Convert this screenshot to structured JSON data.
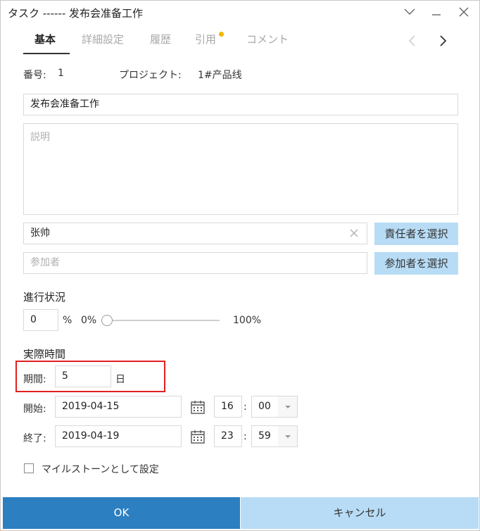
{
  "window": {
    "title": "タスク ------ 发布会准备工作"
  },
  "tabs": [
    {
      "label": "基本",
      "active": true
    },
    {
      "label": "詳細設定",
      "active": false
    },
    {
      "label": "履歴",
      "active": false
    },
    {
      "label": "引用",
      "active": false,
      "badge": true
    },
    {
      "label": "コメント",
      "active": false
    }
  ],
  "info": {
    "number_label": "番号:",
    "number_value": "1",
    "project_label": "プロジェクト:",
    "project_value": "1#产品线"
  },
  "form": {
    "task_name": "发布会准备工作",
    "description_placeholder": "説明",
    "assignee": "张帅",
    "assignee_button": "責任者を選択",
    "participants_placeholder": "参加者",
    "participants_button": "参加者を選択"
  },
  "progress": {
    "section_title": "進行状況",
    "value": "0",
    "percent_sign": "%",
    "min_label": "0%",
    "max_label": "100%",
    "fraction": 0
  },
  "actual_time": {
    "section_title": "実際時間",
    "duration_label": "期間:",
    "duration_value": "5",
    "duration_unit": "日",
    "start_label": "開始:",
    "start_date": "2019-04-15",
    "start_hour": "16",
    "start_minute": "00",
    "end_label": "終了:",
    "end_date": "2019-04-19",
    "end_hour": "23",
    "end_minute": "59",
    "time_separator": ":"
  },
  "milestone": {
    "label": "マイルストーンとして設定",
    "checked": false
  },
  "footer": {
    "ok_label": "OK",
    "cancel_label": "キャンセル"
  },
  "colors": {
    "primary": "#2c7fc1",
    "light_button": "#b8dcf5",
    "highlight": "#e02020",
    "badge": "#f5b400"
  }
}
